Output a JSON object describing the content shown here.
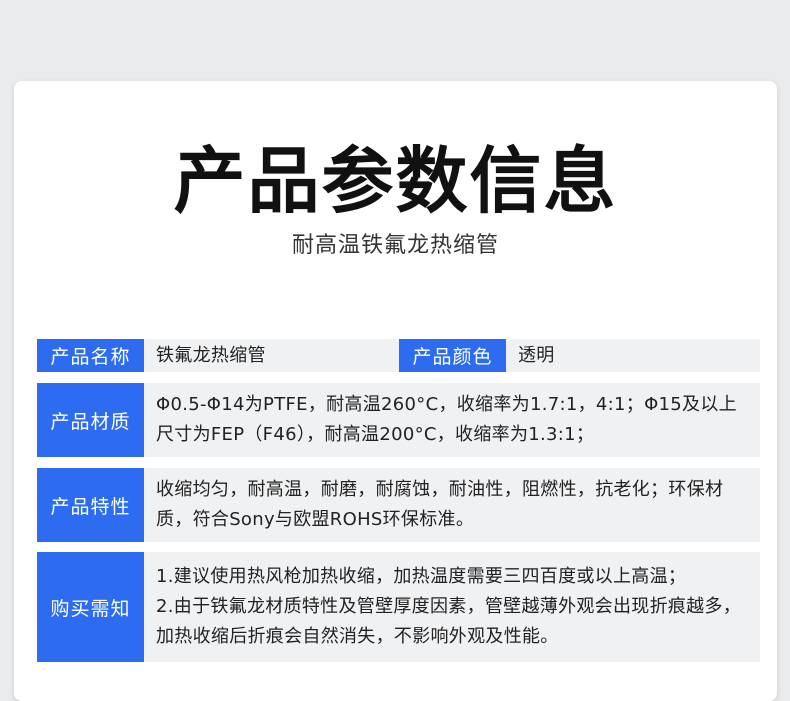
{
  "header": {
    "title": "产品参数信息",
    "subtitle": "耐高温铁氟龙热缩管"
  },
  "rows": {
    "name": {
      "label": "产品名称",
      "value": "铁氟龙热缩管",
      "label2": "产品颜色",
      "value2": "透明"
    },
    "material": {
      "label": "产品材质",
      "value": "Φ0.5-Φ14为PTFE，耐高温260°C，收缩率为1.7:1，4:1；Φ15及以上尺寸为FEP（F46），耐高温200°C，收缩率为1.3:1；"
    },
    "features": {
      "label": "产品特性",
      "value": "收缩均匀，耐高温，耐磨，耐腐蚀，耐油性，阻燃性，抗老化；环保材质，符合Sony与欧盟ROHS环保标准。"
    },
    "notice": {
      "label": "购买需知",
      "line1": "1.建议使用热风枪加热收缩，加热温度需要三四百度或以上高温；",
      "line2": "2.由于铁氟龙材质特性及管壁厚度因素，管壁越薄外观会出现折痕越多，加热收缩后折痕会自然消失，不影响外观及性能。"
    }
  },
  "colors": {
    "label_bg": "#2d6cf0",
    "value_bg": "#f0f1f3",
    "page_bg": "#eaebed"
  }
}
